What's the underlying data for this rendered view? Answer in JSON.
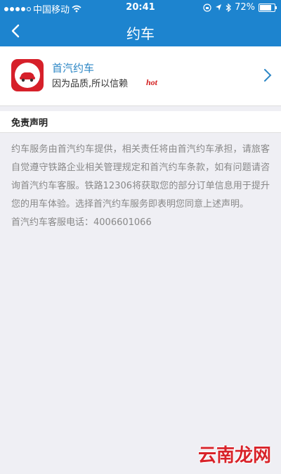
{
  "status_bar": {
    "carrier": "中国移动",
    "time": "20:41",
    "battery": "72%",
    "icons": [
      "signal-dots-icon",
      "wifi-icon",
      "lock-rotation-icon",
      "location-arrow-icon",
      "bluetooth-icon",
      "battery-icon"
    ]
  },
  "nav": {
    "title": "约车",
    "back_icon": "back-chevron-icon"
  },
  "service": {
    "name": "首汽约车",
    "slogan": "因为品质,所以信赖",
    "badge": "hot",
    "icon": "car-icon",
    "chevron_icon": "chevron-right-icon"
  },
  "disclaimer": {
    "heading": "免责声明",
    "body": "约车服务由首汽约车提供，相关责任将由首汽约车承担，请旅客自觉遵守铁路企业相关管理规定和首汽约车条款，如有问题请咨询首汽约车客服。铁路12306将获取您的部分订单信息用于提升您的用车体验。选择首汽约车服务即表明您同意上述声明。",
    "hotline": "首汽约车客服电话：4006601066"
  },
  "watermark": "云南龙网",
  "colors": {
    "primary": "#1d84cf",
    "brand_red": "#d6202a",
    "link_blue": "#2b86c5",
    "background": "#efeff4",
    "muted_text": "#888888"
  }
}
